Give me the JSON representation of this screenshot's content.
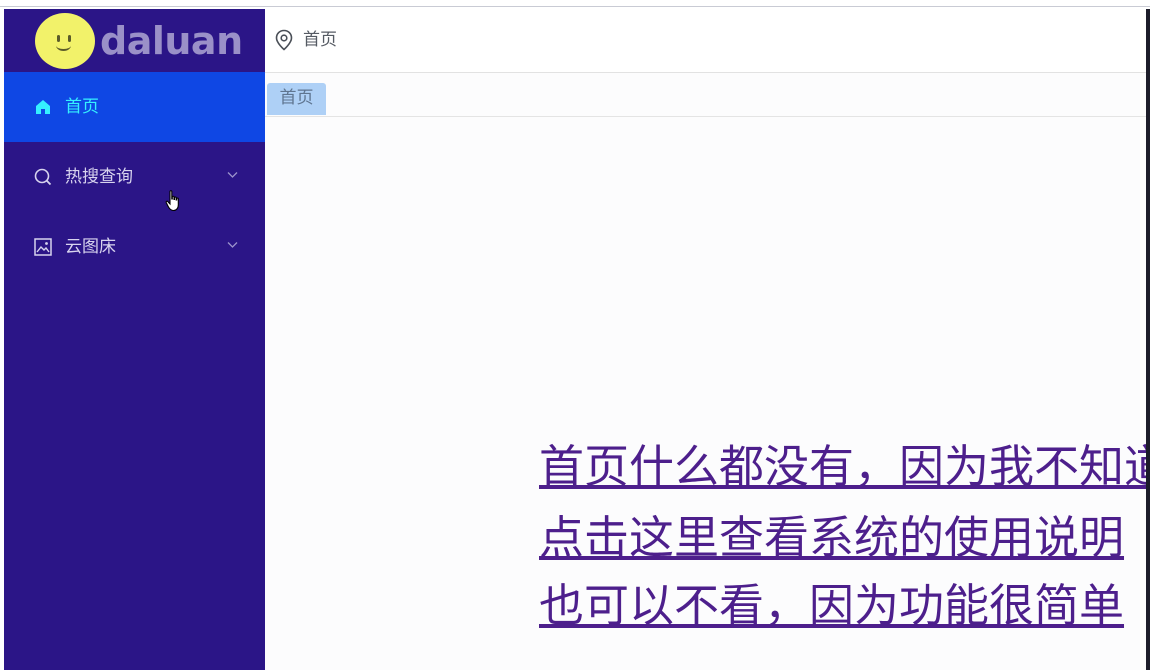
{
  "app": {
    "logo_text": "daluan",
    "logo_icon": "smiley-face-icon"
  },
  "sidebar": {
    "items": [
      {
        "label": "首页",
        "icon": "home-icon",
        "active": true
      },
      {
        "label": "热搜查询",
        "icon": "search-icon",
        "expandable": true
      },
      {
        "label": "云图床",
        "icon": "image-icon",
        "expandable": true
      }
    ]
  },
  "header": {
    "breadcrumb": "首页",
    "icon": "location-pin-icon"
  },
  "tabs": [
    {
      "label": "首页",
      "active": true
    }
  ],
  "main": {
    "lines": [
      "首页什么都没有，因为我不知道放什么",
      "点击这里查看系统的使用说明",
      "也可以不看，因为功能很简单"
    ]
  },
  "colors": {
    "sidebar_bg": "#2b1587",
    "active_item_bg": "#0f47e4",
    "active_item_text": "#35f0ff",
    "link_text": "#4d1f8c",
    "tab_bg": "#aed0f6"
  }
}
